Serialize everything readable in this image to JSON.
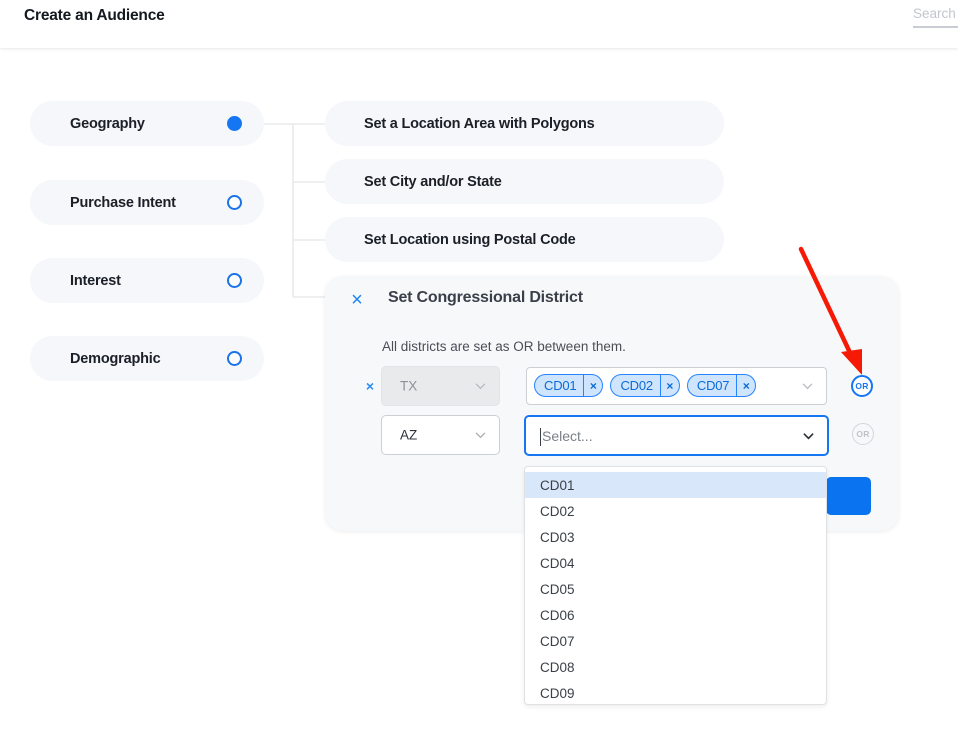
{
  "topbar": {
    "title": "Create an Audience",
    "search_placeholder": "Search",
    "search_value": ""
  },
  "categories": [
    {
      "label": "Geography",
      "selected": true
    },
    {
      "label": "Purchase Intent",
      "selected": false
    },
    {
      "label": "Interest",
      "selected": false
    },
    {
      "label": "Demographic",
      "selected": false
    }
  ],
  "options": [
    {
      "label": "Set a Location Area with Polygons"
    },
    {
      "label": "Set City and/or State"
    },
    {
      "label": "Set Location using Postal Code"
    }
  ],
  "modal": {
    "close_label": "×",
    "title": "Set Congressional District",
    "subtitle": "All districts are set as OR between them.",
    "rows": [
      {
        "remove_label": "×",
        "state": "TX",
        "state_disabled": true,
        "chips": [
          {
            "label": "CD01",
            "remove_label": "×"
          },
          {
            "label": "CD02",
            "remove_label": "×"
          },
          {
            "label": "CD07",
            "remove_label": "×"
          }
        ],
        "operator": "OR",
        "operator_active": true
      },
      {
        "state": "AZ",
        "state_disabled": false,
        "select_placeholder": "Select...",
        "select_value": "",
        "operator": "OR",
        "operator_active": false
      }
    ],
    "dropdown": {
      "highlighted": "CD01",
      "options": [
        "CD01",
        "CD02",
        "CD03",
        "CD04",
        "CD05",
        "CD06",
        "CD07",
        "CD08",
        "CD09"
      ]
    },
    "primary_button_label": ""
  },
  "colors": {
    "accent_blue": "#1476f2",
    "chip_fill": "#cfe4fd",
    "chip_border": "#2684ff",
    "pill_bg": "#f5f7fa",
    "card_bg": "#f7f8fa",
    "highlight": "#d9e7fb",
    "annotation_red": "#f61a06"
  }
}
